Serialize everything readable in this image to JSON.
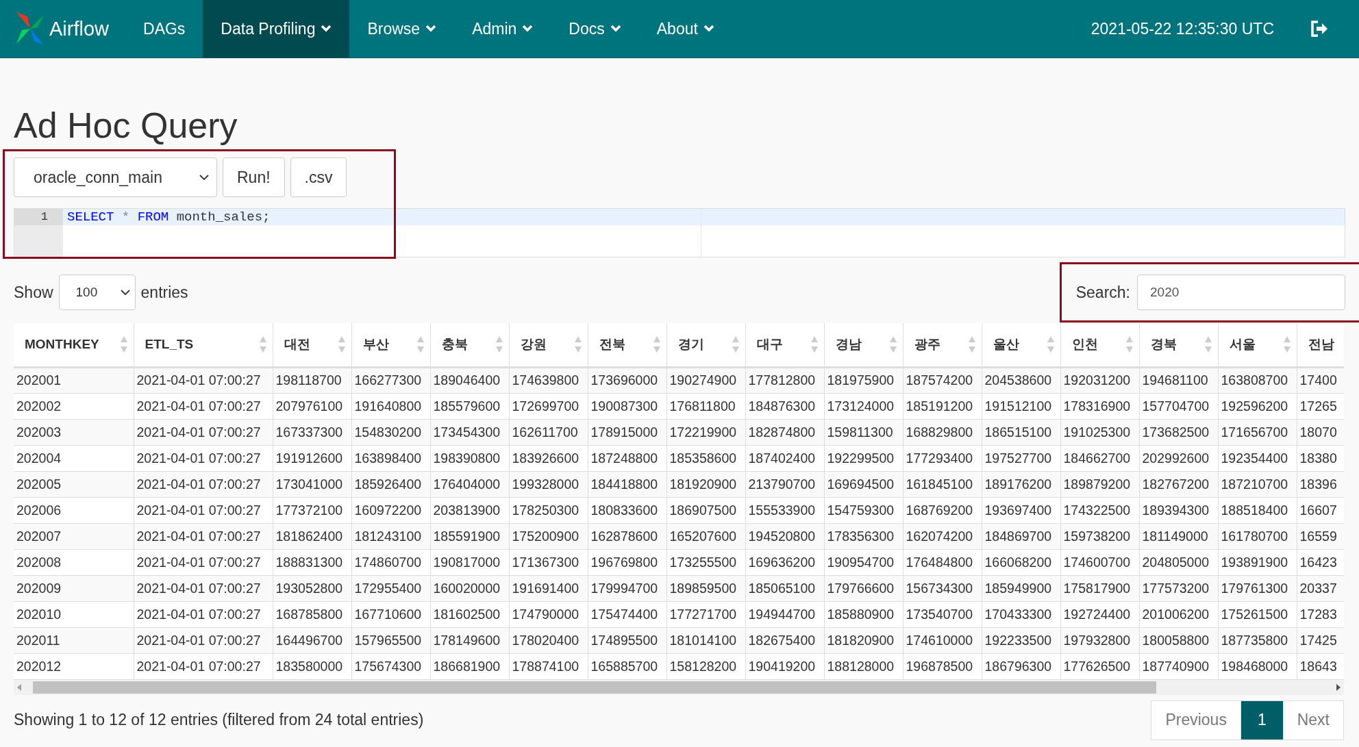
{
  "navbar": {
    "brand": "Airflow",
    "items": [
      {
        "label": "DAGs",
        "selected": false,
        "dropdown": false
      },
      {
        "label": "Data Profiling",
        "selected": true,
        "dropdown": true
      },
      {
        "label": "Browse",
        "selected": false,
        "dropdown": true
      },
      {
        "label": "Admin",
        "selected": false,
        "dropdown": true
      },
      {
        "label": "Docs",
        "selected": false,
        "dropdown": true
      },
      {
        "label": "About",
        "selected": false,
        "dropdown": true
      }
    ],
    "clock": "2021-05-22 12:35:30 UTC"
  },
  "page_title": "Ad Hoc Query",
  "query_form": {
    "connection": "oracle_conn_main",
    "buttons": [
      "Run!",
      ".csv"
    ],
    "editor": {
      "lines": [
        {
          "number": "1",
          "tokens": [
            {
              "kind": "keyword",
              "text": "SELECT"
            },
            {
              "kind": "operator",
              "text": " * "
            },
            {
              "kind": "keyword",
              "text": "FROM"
            },
            {
              "kind": "plain",
              "text": " month_sales;"
            }
          ]
        }
      ]
    }
  },
  "table_controls": {
    "show_label": "Show",
    "page_length": "100",
    "entries_label": "entries",
    "search_label": "Search:",
    "search_value": "2020"
  },
  "table": {
    "columns": [
      "MONTHKEY",
      "ETL_TS",
      "대전",
      "부산",
      "충북",
      "강원",
      "전북",
      "경기",
      "대구",
      "경남",
      "광주",
      "울산",
      "인천",
      "경북",
      "서울",
      "전남"
    ],
    "rows": [
      [
        "202001",
        "2021-04-01 07:00:27",
        "198118700",
        "166277300",
        "189046400",
        "174639800",
        "173696000",
        "190274900",
        "177812800",
        "181975900",
        "187574200",
        "204538600",
        "192031200",
        "194681100",
        "163808700",
        "17400"
      ],
      [
        "202002",
        "2021-04-01 07:00:27",
        "207976100",
        "191640800",
        "185579600",
        "172699700",
        "190087300",
        "176811800",
        "184876300",
        "173124000",
        "185191200",
        "191512100",
        "178316900",
        "157704700",
        "192596200",
        "17265"
      ],
      [
        "202003",
        "2021-04-01 07:00:27",
        "167337300",
        "154830200",
        "173454300",
        "162611700",
        "178915000",
        "172219900",
        "182874800",
        "159811300",
        "168829800",
        "186515100",
        "191025300",
        "173682500",
        "171656700",
        "18070"
      ],
      [
        "202004",
        "2021-04-01 07:00:27",
        "191912600",
        "163898400",
        "198390800",
        "183926600",
        "187248800",
        "185358600",
        "187402400",
        "192299500",
        "177293400",
        "197527700",
        "184662700",
        "202992600",
        "192354400",
        "18380"
      ],
      [
        "202005",
        "2021-04-01 07:00:27",
        "173041000",
        "185926400",
        "176404000",
        "199328000",
        "184418800",
        "181920900",
        "213790700",
        "169694500",
        "161845100",
        "189176200",
        "189879200",
        "182767200",
        "187210700",
        "18396"
      ],
      [
        "202006",
        "2021-04-01 07:00:27",
        "177372100",
        "160972200",
        "203813900",
        "178250300",
        "180833600",
        "186907500",
        "155533900",
        "154759300",
        "168769200",
        "193697400",
        "174322500",
        "189394300",
        "188518400",
        "16607"
      ],
      [
        "202007",
        "2021-04-01 07:00:27",
        "181862400",
        "181243100",
        "185591900",
        "175200900",
        "162878600",
        "165207600",
        "194520800",
        "178356300",
        "162074200",
        "184869700",
        "159738200",
        "181149000",
        "161780700",
        "16559"
      ],
      [
        "202008",
        "2021-04-01 07:00:27",
        "188831300",
        "174860700",
        "190817000",
        "171367300",
        "196769800",
        "173255500",
        "169636200",
        "190954700",
        "176484800",
        "166068200",
        "174600700",
        "204805000",
        "193891900",
        "16423"
      ],
      [
        "202009",
        "2021-04-01 07:00:27",
        "193052800",
        "172955400",
        "160020000",
        "191691400",
        "179994700",
        "189859500",
        "185065100",
        "179766600",
        "156734300",
        "185949900",
        "175817900",
        "177573200",
        "179761300",
        "20337"
      ],
      [
        "202010",
        "2021-04-01 07:00:27",
        "168785800",
        "167710600",
        "181602500",
        "174790000",
        "175474400",
        "177271700",
        "194944700",
        "185880900",
        "173540700",
        "170433300",
        "192724400",
        "201006200",
        "175261500",
        "17283"
      ],
      [
        "202011",
        "2021-04-01 07:00:27",
        "164496700",
        "157965500",
        "178149600",
        "178020400",
        "174895500",
        "181014100",
        "182675400",
        "181820900",
        "174610000",
        "192233500",
        "197932800",
        "180058800",
        "187735800",
        "17425"
      ],
      [
        "202012",
        "2021-04-01 07:00:27",
        "183580000",
        "175674300",
        "186681900",
        "178874100",
        "165885700",
        "158128200",
        "190419200",
        "188128000",
        "196878500",
        "186796300",
        "177626500",
        "187740900",
        "198468000",
        "18643"
      ]
    ]
  },
  "footer": {
    "info": "Showing 1 to 12 of 12 entries (filtered from 24 total entries)",
    "pagination": [
      {
        "label": "Previous",
        "kind": "nav",
        "selected": false
      },
      {
        "label": "1",
        "kind": "page",
        "selected": true
      },
      {
        "label": "Next",
        "kind": "nav",
        "selected": false
      }
    ]
  }
}
